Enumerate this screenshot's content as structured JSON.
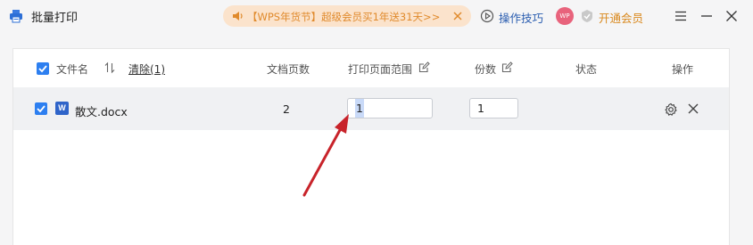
{
  "app": {
    "title": "批量打印"
  },
  "promo": {
    "text": "【WPS年货节】超级会员买1年送31天>>"
  },
  "header_actions": {
    "tips_label": "操作技巧",
    "avatar_text": "WP",
    "vip_label": "开通会员"
  },
  "table": {
    "columns": {
      "filename": "文件名",
      "clear": "清除(1)",
      "pages": "文档页数",
      "print_range": "打印页面范围",
      "copies": "份数",
      "status": "状态",
      "actions": "操作"
    },
    "rows": [
      {
        "checked": true,
        "icon_letter": "W",
        "filename": "散文.docx",
        "pages": "2",
        "print_range": "1",
        "copies": "1",
        "status": ""
      }
    ]
  },
  "colors": {
    "accent": "#2d7ff0",
    "word_icon": "#2f64c9",
    "promo_bg": "#fbe3cc",
    "promo_text": "#e08a2c",
    "link_blue": "#2a5db0",
    "vip_gold": "#d9891e",
    "annotation_arrow": "#c8232a"
  }
}
